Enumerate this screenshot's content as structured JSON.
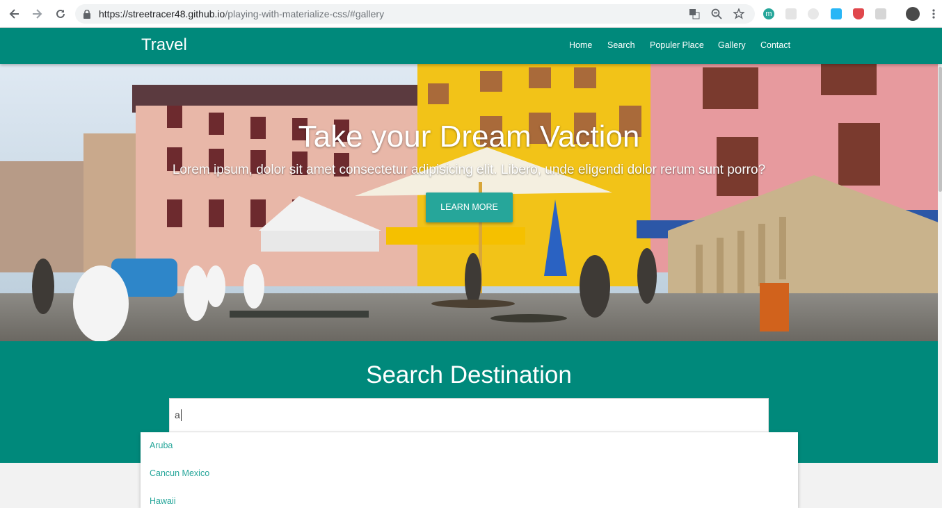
{
  "browser": {
    "url_host": "https://streetracer48.github.io",
    "url_path": "/playing-with-materialize-css/#gallery",
    "icons": [
      "back-icon",
      "forward-icon",
      "reload-icon",
      "lock-icon",
      "translate-icon",
      "zoom-icon",
      "star-icon"
    ],
    "extensions": [
      {
        "name": "m-extension",
        "letter": "m",
        "color": "#26a69a"
      },
      {
        "name": "grid-extension",
        "letter": "",
        "color": "#d9d9d9"
      },
      {
        "name": "timer-extension",
        "letter": "",
        "color": "#cfcfcf"
      },
      {
        "name": "cast-extension",
        "letter": "",
        "color": "#1da1f2"
      },
      {
        "name": "shield-extension",
        "letter": "",
        "color": "#e0474c"
      },
      {
        "name": "screen-extension",
        "letter": "",
        "color": "#cfcfcf"
      }
    ]
  },
  "navbar": {
    "brand": "Travel",
    "items": [
      "Home",
      "Search",
      "Populer Place",
      "Gallery",
      "Contact"
    ],
    "color": "#00897b"
  },
  "hero": {
    "title": "Take your Dream Vaction",
    "subtitle": "Lorem ipsum, dolor sit amet consectetur adipisicing elit. Libero, unde eligendi dolor rerum sunt porro?",
    "button": "LEARN MORE",
    "button_color": "#26a69a"
  },
  "search": {
    "title": "Search Destination",
    "value": "a",
    "suggestions": [
      {
        "label": "Aruba"
      },
      {
        "label": "Cancun Mexico"
      },
      {
        "label": "Hawaii"
      }
    ]
  }
}
